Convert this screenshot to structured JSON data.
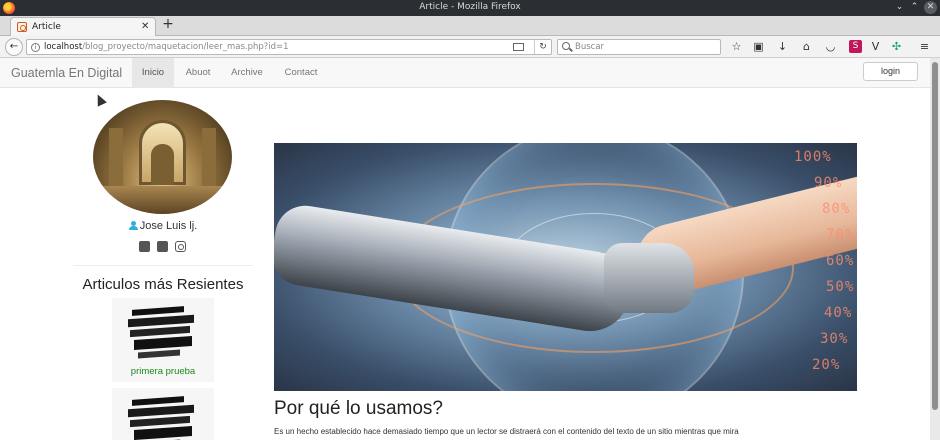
{
  "browser": {
    "window_title": "Article - Mozilla Firefox",
    "tab_label": "Article",
    "url_host": "localhost",
    "url_path": "/blog_proyecto/maquetacion/leer_mas.php?id=1",
    "search_placeholder": "Buscar",
    "toolbar_icons": [
      "bookmark-star-icon",
      "library-icon",
      "download-icon",
      "home-icon",
      "pocket-icon",
      "extension-s-icon",
      "extension-v-icon",
      "extension-puzzle-icon",
      "menu-icon"
    ]
  },
  "site": {
    "brand": "Guatemla En Digital",
    "nav": [
      {
        "label": "Inicio",
        "active": true
      },
      {
        "label": "Abuot",
        "active": false
      },
      {
        "label": "Archive",
        "active": false
      },
      {
        "label": "Contact",
        "active": false
      }
    ],
    "login_label": "login"
  },
  "sidebar": {
    "author_name": "Jose Luis lj.",
    "social_icons": [
      "twitter-icon",
      "facebook-icon",
      "instagram-icon"
    ],
    "recent_heading": "Articulos más Resientes",
    "recent_items": [
      {
        "title": "primera prueba"
      },
      {
        "title": ""
      }
    ]
  },
  "article": {
    "title": "Por qué lo usamos?",
    "body": "Es un hecho establecido hace demasiado tiempo que un lector se distraerá con el contenido del texto de un sitio mientras que mira",
    "hero_percent_labels": [
      "100%",
      "90%",
      "80%",
      "70%",
      "60%",
      "50%",
      "40%",
      "30%",
      "20%"
    ]
  },
  "colors": {
    "accent_user_icon": "#31b0d5",
    "recent_link": "#1a8a1a"
  }
}
